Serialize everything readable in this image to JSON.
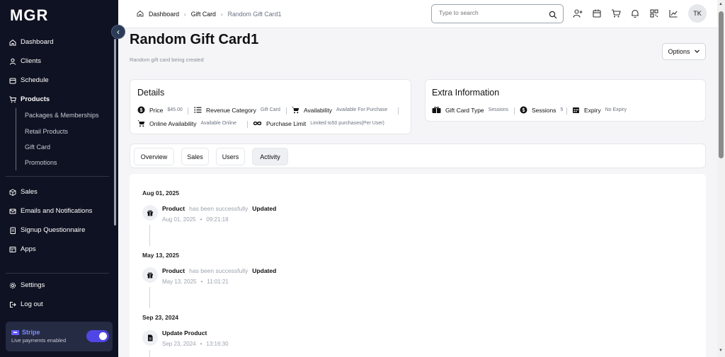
{
  "app": {
    "logo": "MGR"
  },
  "sidebar": {
    "items": [
      {
        "label": "Dashboard",
        "icon": "home-icon"
      },
      {
        "label": "Clients",
        "icon": "user-icon"
      },
      {
        "label": "Schedule",
        "icon": "calendar-icon"
      },
      {
        "label": "Products",
        "icon": "cart-icon"
      }
    ],
    "subitems": [
      "Packages & Memberships",
      "Retail Products",
      "Gift Card",
      "Promotions"
    ],
    "items2": [
      {
        "label": "Sales",
        "icon": "box-icon"
      },
      {
        "label": "Emails and Notifications",
        "icon": "mail-icon"
      },
      {
        "label": "Signup Questionnaire",
        "icon": "document-icon"
      },
      {
        "label": "Apps",
        "icon": "apps-icon"
      }
    ],
    "bottom": [
      {
        "label": "Settings",
        "icon": "gear-icon"
      },
      {
        "label": "Log out",
        "icon": "logout-icon"
      }
    ],
    "stripe": {
      "title": "Stripe",
      "subtitle": "Live payments enabled",
      "enabled": true,
      "accent": "#635bff"
    }
  },
  "header": {
    "breadcrumbs": [
      "Dashboard",
      "Gift Card",
      "Random Gift Card1"
    ],
    "search_placeholder": "Type to search",
    "avatar_initials": "TK"
  },
  "page": {
    "title": "Random Gift Card1",
    "subtitle": "Random gift card being created",
    "options_label": "Options"
  },
  "details": {
    "title": "Details",
    "price_label": "Price",
    "price_value": "$45.00",
    "revenue_label": "Revenue Category",
    "revenue_value": "Gift Card",
    "availability_label": "Availability",
    "availability_value": "Available For Purchase",
    "online_label": "Online Availability",
    "online_value": "Available Online",
    "limit_label": "Purchase Limit",
    "limit_value": "Limited to50 purchases(Per User)"
  },
  "extra": {
    "title": "Extra Information",
    "type_label": "Gift Card Type",
    "type_value": "Sessions",
    "sessions_label": "Sessions",
    "sessions_value": "5",
    "expiry_label": "Expiry",
    "expiry_value": "No Expiry"
  },
  "tabs": [
    "Overview",
    "Sales",
    "Users",
    "Activity"
  ],
  "active_tab": "Activity",
  "activity": [
    {
      "date": "Aug 01, 2025",
      "subject": "Product",
      "text": "has been successfully",
      "action": "Updated",
      "time_date": "Aug 01, 2025",
      "time": "09:21:18",
      "icon": "gift-icon"
    },
    {
      "date": "May 13, 2025",
      "subject": "Product",
      "text": "has been successfully",
      "action": "Updated",
      "time_date": "May 13, 2025",
      "time": "11:01:21",
      "icon": "gift-icon"
    },
    {
      "date": "Sep 23, 2024",
      "subject": "Update Product",
      "text": "",
      "action": "",
      "time_date": "Sep 23, 2024",
      "time": "13:16:30",
      "icon": "document-icon"
    }
  ],
  "colors": {
    "sidebar_bg": "#0f1222",
    "accent": "#4f46e5"
  }
}
